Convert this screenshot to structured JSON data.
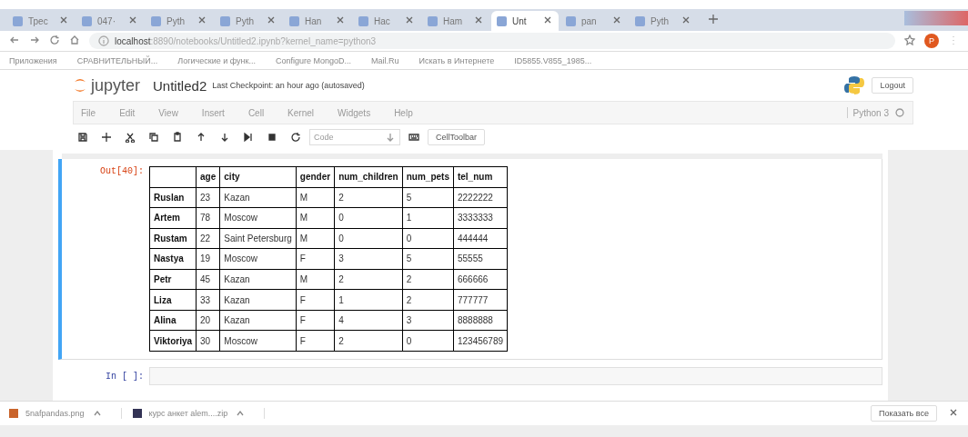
{
  "browser": {
    "tabs": [
      {
        "label": "Трес",
        "selected": false
      },
      {
        "label": "047·",
        "selected": false
      },
      {
        "label": "Pyth",
        "selected": false
      },
      {
        "label": "Pyth",
        "selected": false
      },
      {
        "label": "Han",
        "selected": false
      },
      {
        "label": "Hac",
        "selected": false
      },
      {
        "label": "Ham",
        "selected": false
      },
      {
        "label": "Unt",
        "selected": true
      },
      {
        "label": "pan",
        "selected": false
      },
      {
        "label": "Pyth",
        "selected": false
      }
    ],
    "address": {
      "host": "localhost",
      "path": ":8890/notebooks/Untitled2.ipynb?kernel_name=python3"
    },
    "avatar": "P",
    "bookmarks": [
      "Приложения",
      "СРАВНИТЕЛЬНЫЙ...",
      "Логические и функ...",
      "Configure MongoD...",
      "Mail.Ru",
      "Искать в Интернете",
      "ID5855.V855_1985..."
    ]
  },
  "notebook": {
    "logo": "jupyter",
    "title": "Untitled2",
    "checkpoint": "Last Checkpoint: an hour ago (autosaved)",
    "logout": "Logout",
    "menu": [
      "File",
      "Edit",
      "View",
      "Insert",
      "Cell",
      "Kernel",
      "Widgets",
      "Help"
    ],
    "kernel": "Python 3",
    "cell_type": "Code",
    "cell_toolbar": "CellToolbar",
    "output_prompt": "Out[40]:",
    "table": {
      "columns": [
        "",
        "age",
        "city",
        "gender",
        "num_children",
        "num_pets",
        "tel_num"
      ],
      "rows": [
        [
          "Ruslan",
          "23",
          "Kazan",
          "M",
          "2",
          "5",
          "2222222"
        ],
        [
          "Artem",
          "78",
          "Moscow",
          "M",
          "0",
          "1",
          "3333333"
        ],
        [
          "Rustam",
          "22",
          "Saint Petersburg",
          "M",
          "0",
          "0",
          "444444"
        ],
        [
          "Nastya",
          "19",
          "Moscow",
          "F",
          "3",
          "5",
          "55555"
        ],
        [
          "Petr",
          "45",
          "Kazan",
          "M",
          "2",
          "2",
          "666666"
        ],
        [
          "Liza",
          "33",
          "Kazan",
          "F",
          "1",
          "2",
          "777777"
        ],
        [
          "Alina",
          "20",
          "Kazan",
          "F",
          "4",
          "3",
          "8888888"
        ],
        [
          "Viktoriya",
          "30",
          "Moscow",
          "F",
          "2",
          "0",
          "123456789"
        ]
      ]
    },
    "input_prompt": "In [ ]:"
  },
  "downloads": {
    "items": [
      "5nafpandas.png",
      "курс анкет alem....zip"
    ],
    "show_all": "Показать все"
  }
}
